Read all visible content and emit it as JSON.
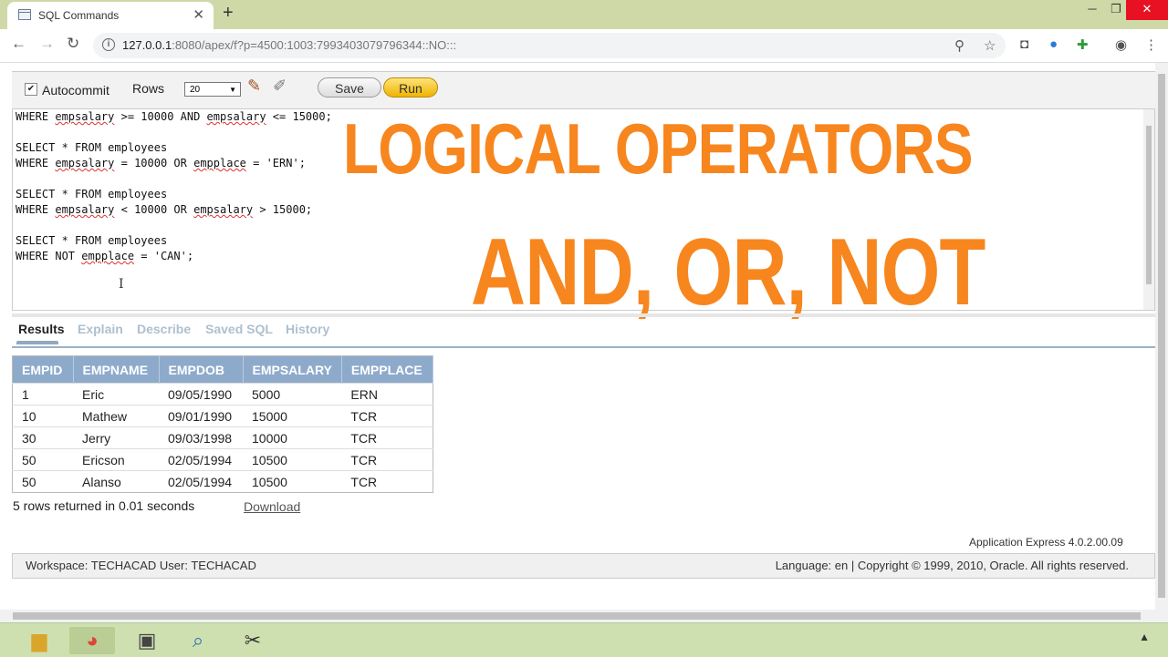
{
  "browser": {
    "tab_title": "SQL Commands",
    "url_host": "127.0.0.1",
    "url_rest": ":8080/apex/f?p=4500:1003:7993403079796344::NO:::"
  },
  "sql_toolbar": {
    "autocommit_label": "Autocommit",
    "rows_label": "Rows",
    "rows_value": "20",
    "save_label": "Save",
    "run_label": "Run"
  },
  "editor": {
    "lines": [
      "WHERE empsalary >= 10000 AND empsalary <= 15000;",
      "",
      "SELECT * FROM employees",
      "WHERE empsalary = 10000 OR empplace = 'ERN';",
      "",
      "SELECT * FROM employees",
      "WHERE empsalary < 10000 OR empsalary > 15000;",
      "",
      "SELECT * FROM employees",
      "WHERE NOT empplace = 'CAN';"
    ]
  },
  "overlay": {
    "line1": "LOGICAL OPERATORS",
    "line2": "AND, OR, NOT"
  },
  "result_tabs": [
    "Results",
    "Explain",
    "Describe",
    "Saved SQL",
    "History"
  ],
  "results": {
    "columns": [
      "EMPID",
      "EMPNAME",
      "EMPDOB",
      "EMPSALARY",
      "EMPPLACE"
    ],
    "rows": [
      [
        "1",
        "Eric",
        "09/05/1990",
        "5000",
        "ERN"
      ],
      [
        "10",
        "Mathew",
        "09/01/1990",
        "15000",
        "TCR"
      ],
      [
        "30",
        "Jerry",
        "09/03/1998",
        "10000",
        "TCR"
      ],
      [
        "50",
        "Ericson",
        "02/05/1994",
        "10500",
        "TCR"
      ],
      [
        "50",
        "Alanso",
        "02/05/1994",
        "10500",
        "TCR"
      ]
    ],
    "summary": "5 rows returned in 0.01 seconds",
    "download_label": "Download"
  },
  "footer": {
    "version": "Application Express 4.0.2.00.09",
    "workspace": "Workspace: TECHACAD User: TECHACAD",
    "copyright": "Language: en | Copyright © 1999, 2010, Oracle. All rights reserved."
  },
  "colors": {
    "overlay_text": "#f7861f",
    "table_header": "#8eaacb",
    "run_button": "#f0b400"
  }
}
